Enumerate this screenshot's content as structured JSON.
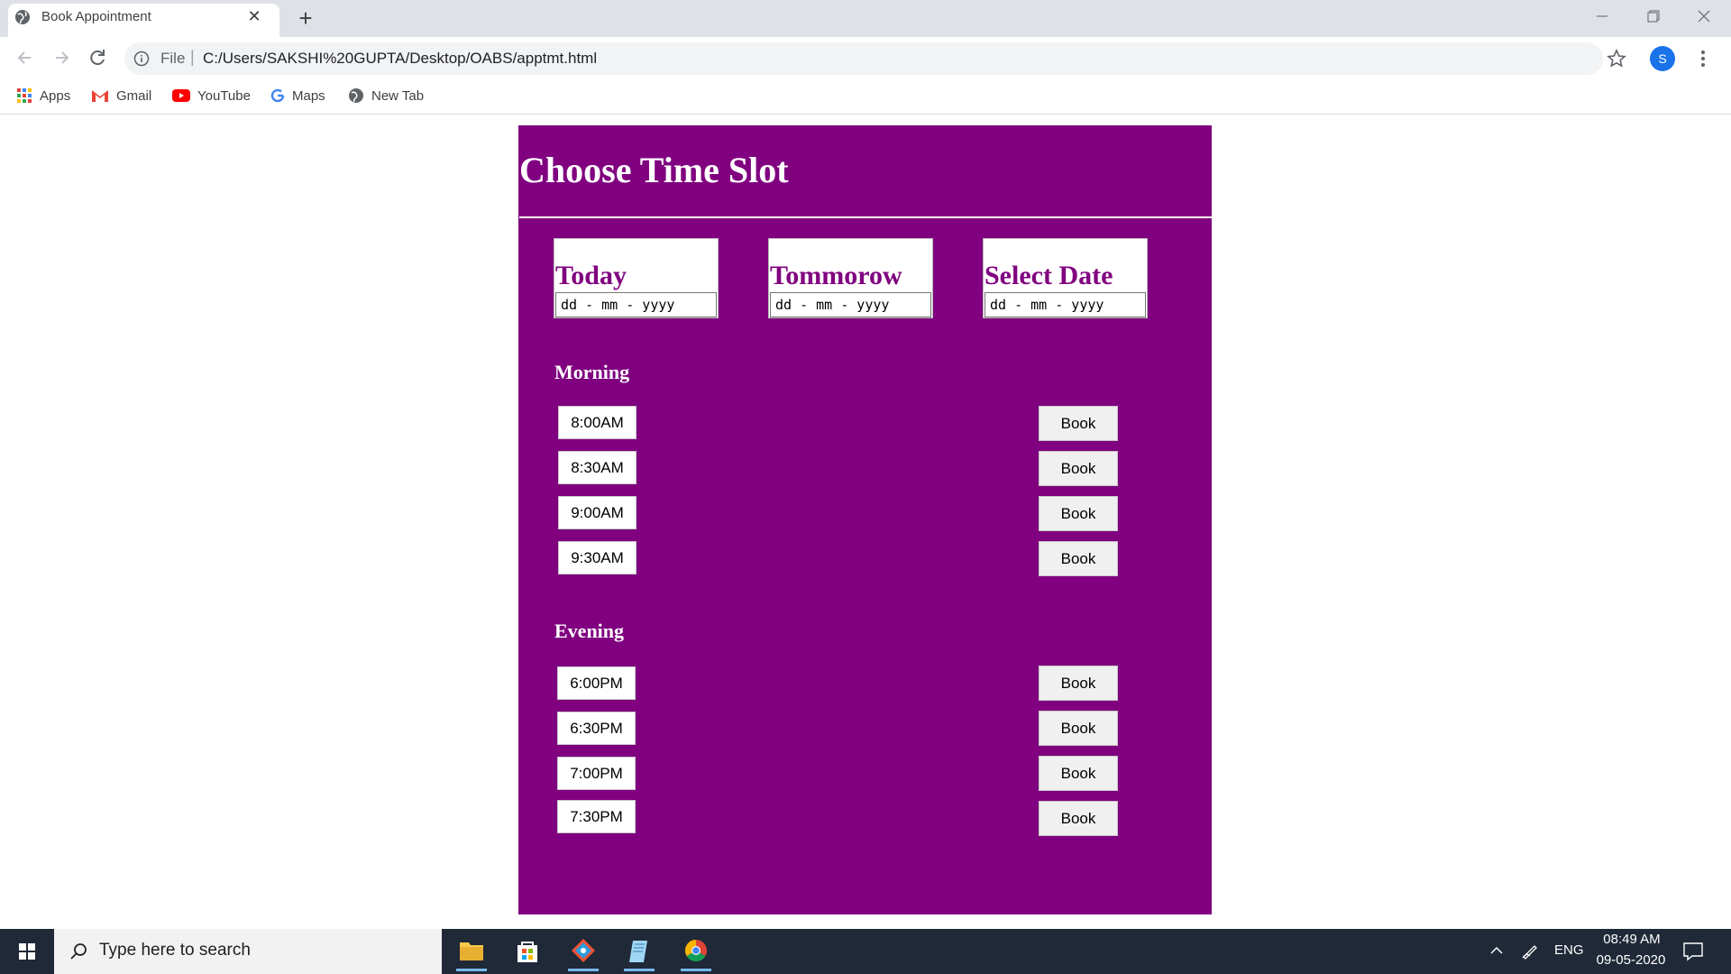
{
  "browser": {
    "tab_title": "Book Appointment",
    "url_scheme": "File",
    "url": "C:/Users/SAKSHI%20GUPTA/Desktop/OABS/apptmt.html",
    "avatar_letter": "S",
    "bookmarks": [
      {
        "label": "Apps",
        "icon": "apps-grid-icon"
      },
      {
        "label": "Gmail",
        "icon": "gmail-icon"
      },
      {
        "label": "YouTube",
        "icon": "youtube-icon"
      },
      {
        "label": "Maps",
        "icon": "google-icon"
      },
      {
        "label": "New Tab",
        "icon": "globe-icon"
      }
    ]
  },
  "page": {
    "title": "Choose Time Slot",
    "background_color": "#800080",
    "dates": [
      {
        "label": "Today",
        "placeholder": "dd - mm - yyyy"
      },
      {
        "label": "Tommorow",
        "placeholder": "dd - mm - yyyy"
      },
      {
        "label": "Select Date",
        "placeholder": "dd - mm - yyyy"
      }
    ],
    "morning": {
      "heading": "Morning",
      "slots": [
        "8:00AM",
        "8:30AM",
        "9:00AM",
        "9:30AM"
      ]
    },
    "evening": {
      "heading": "Evening",
      "slots": [
        "6:00PM",
        "6:30PM",
        "7:00PM",
        "7:30PM"
      ]
    },
    "book_label": "Book"
  },
  "taskbar": {
    "search_placeholder": "Type here to search",
    "language": "ENG",
    "time": "08:49 AM",
    "date": "09-05-2020"
  }
}
